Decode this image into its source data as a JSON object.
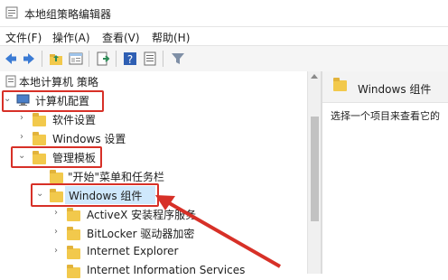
{
  "window": {
    "title": "本地组策略编辑器"
  },
  "menu": [
    "文件(F)",
    "操作(A)",
    "查看(V)",
    "帮助(H)"
  ],
  "toolbar": {
    "icons": [
      "back-arrow-icon",
      "forward-arrow-icon",
      "up-folder-icon",
      "show-hide-tree-icon",
      "export-list-icon",
      "help-icon",
      "properties-icon",
      "filter-icon"
    ]
  },
  "tree": {
    "root": "本地计算机 策略",
    "computer_config": "计算机配置",
    "software_settings": "软件设置",
    "windows_settings": "Windows 设置",
    "admin_templates": "管理模板",
    "start_menu": "\"开始\"菜单和任务栏",
    "windows_components": "Windows 组件",
    "activex": "ActiveX 安装程序服务",
    "bitlocker": "BitLocker 驱动器加密",
    "ie": "Internet Explorer",
    "iis": "Internet Information Services"
  },
  "right_pane": {
    "header": "Windows 组件",
    "description": "选择一个项目来查看它的"
  },
  "colors": {
    "highlight_box": "#d73027",
    "arrow": "#d73027",
    "folder": "#f2c94c"
  }
}
